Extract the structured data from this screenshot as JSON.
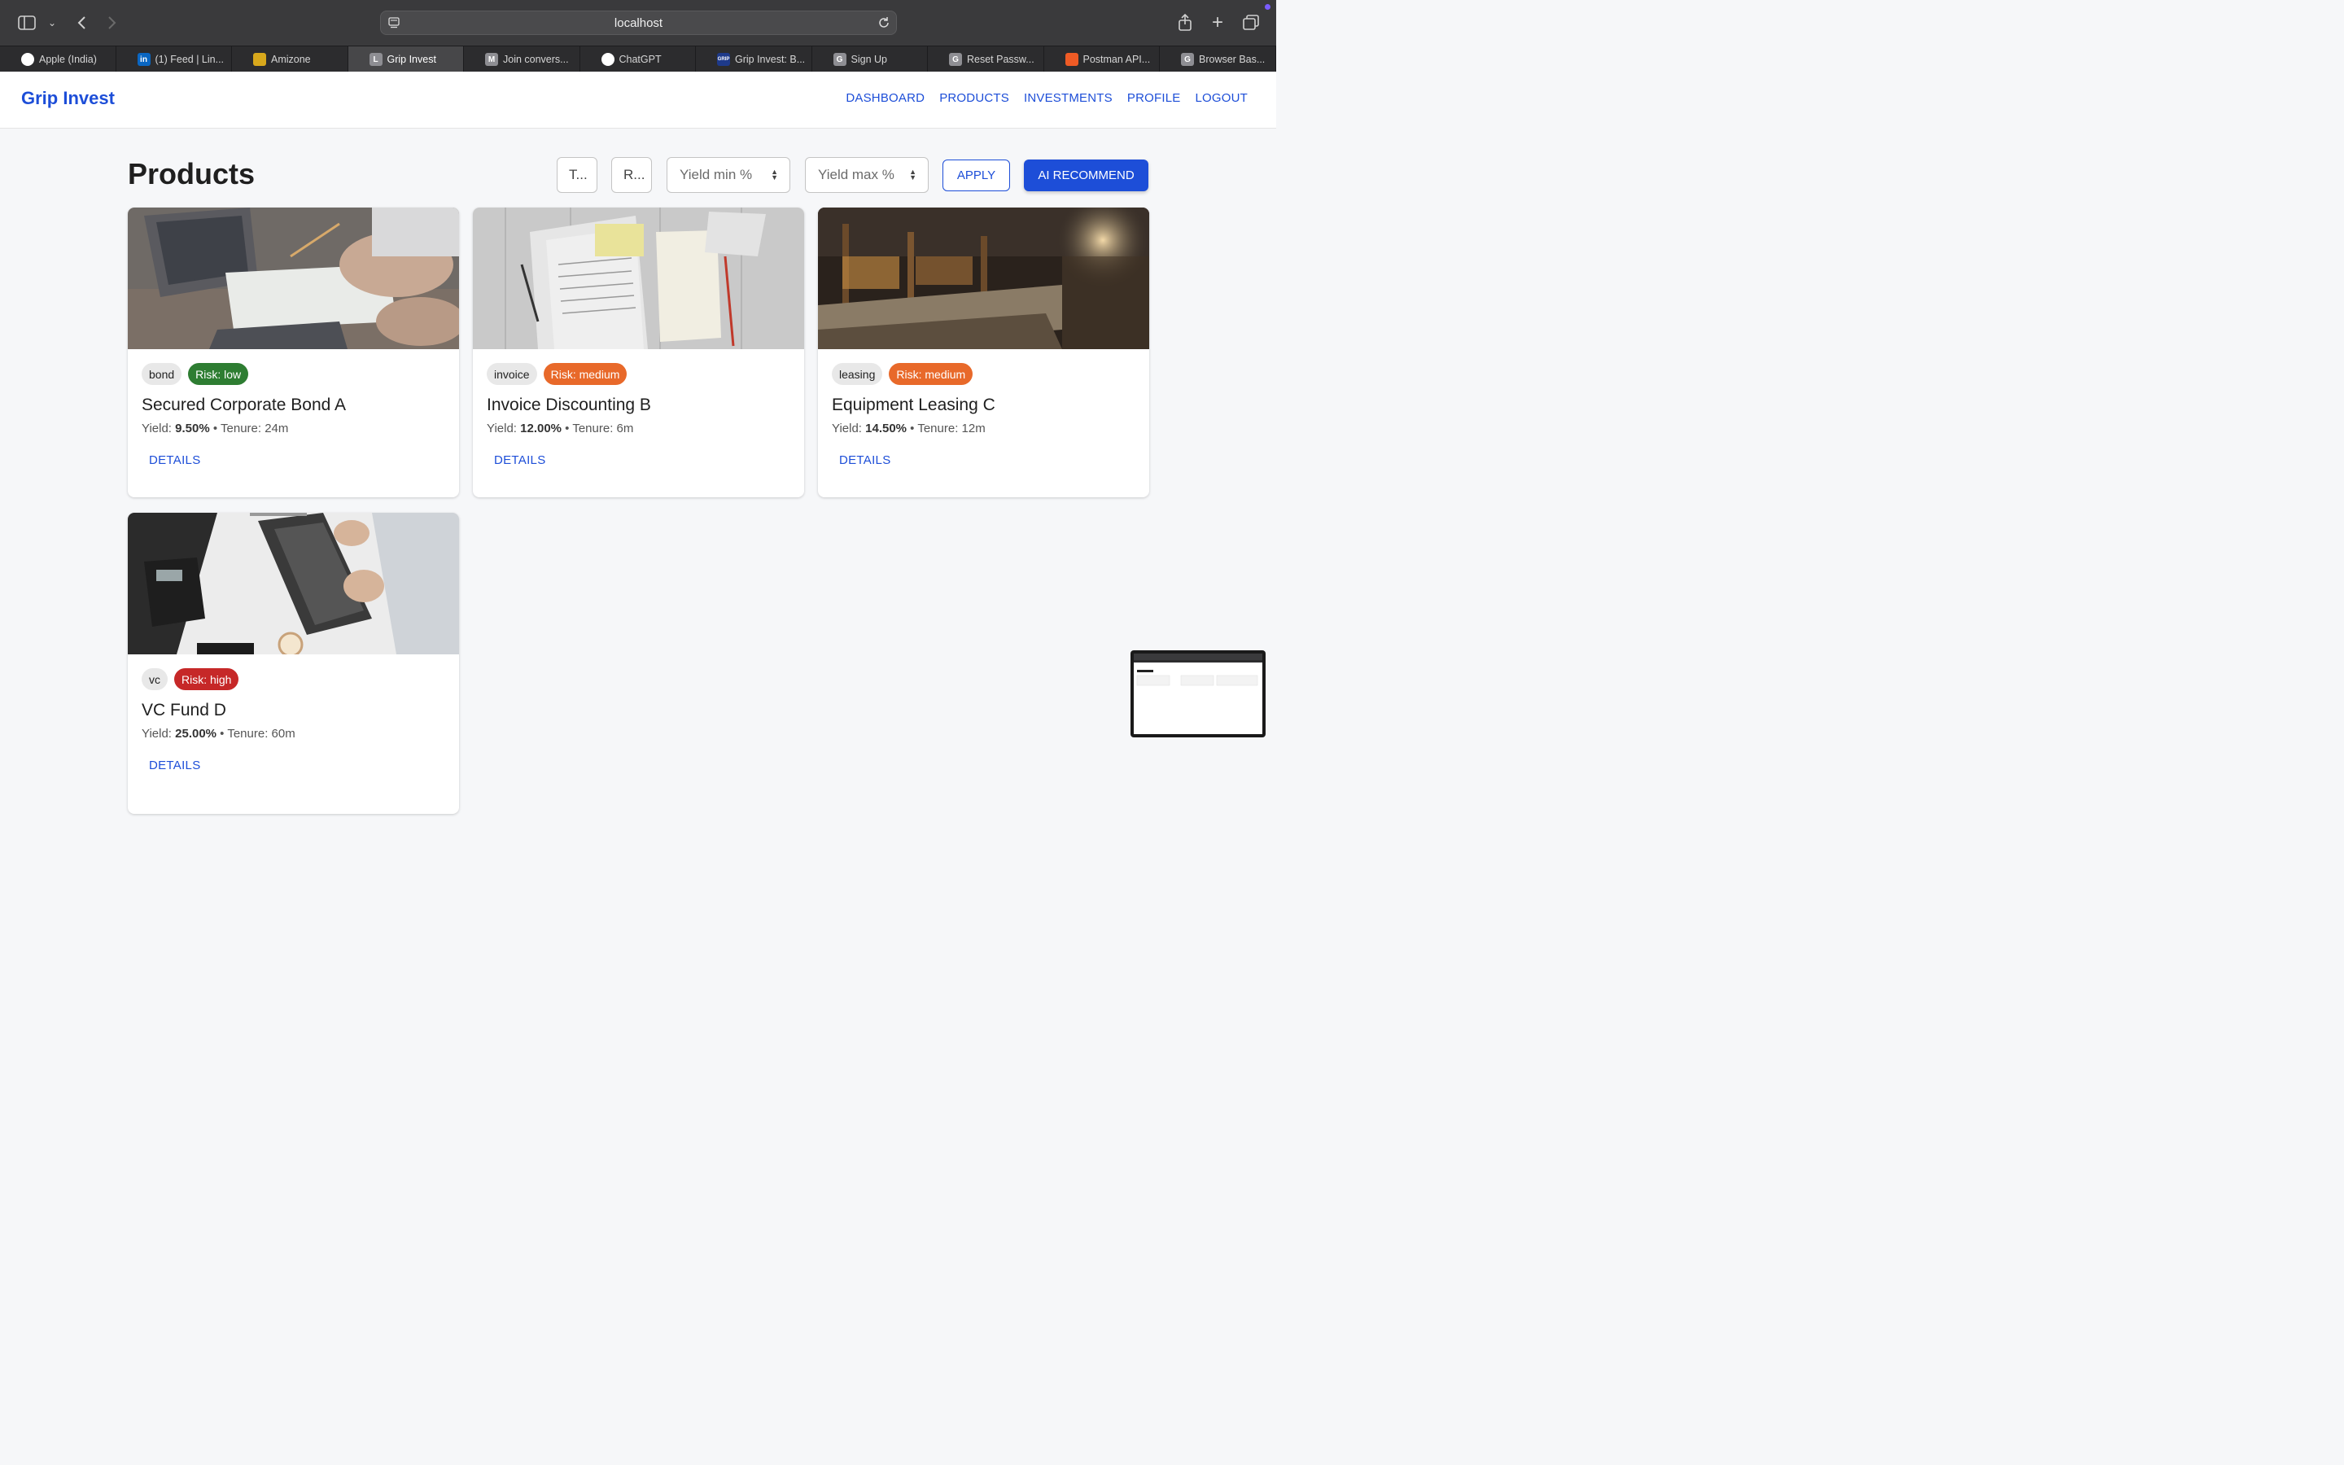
{
  "browser": {
    "url": "localhost",
    "tabs": [
      {
        "label": "Apple (India)",
        "icon": "apple-icon",
        "color": "#ffffff",
        "glyph": ""
      },
      {
        "label": "(1) Feed | Lin...",
        "icon": "linkedin-icon",
        "color": "#0a66c2",
        "glyph": "in"
      },
      {
        "label": "Amizone",
        "icon": "amizone-icon",
        "color": "#d8a81c",
        "glyph": ""
      },
      {
        "label": "Grip Invest",
        "icon": "letter-l-icon",
        "color": "#8e8e93",
        "glyph": "L",
        "active": true
      },
      {
        "label": "Join convers...",
        "icon": "letter-m-icon",
        "color": "#8e8e93",
        "glyph": "M"
      },
      {
        "label": "ChatGPT",
        "icon": "chatgpt-icon",
        "color": "#ffffff",
        "glyph": ""
      },
      {
        "label": "Grip Invest: B...",
        "icon": "grip-icon",
        "color": "#1e3a8a",
        "glyph": "GRIP"
      },
      {
        "label": "Sign Up",
        "icon": "letter-g-icon",
        "color": "#8e8e93",
        "glyph": "G"
      },
      {
        "label": "Reset Passw...",
        "icon": "letter-g-icon",
        "color": "#8e8e93",
        "glyph": "G"
      },
      {
        "label": "Postman API...",
        "icon": "postman-icon",
        "color": "#ef5b25",
        "glyph": ""
      },
      {
        "label": "Browser Bas...",
        "icon": "letter-g-icon",
        "color": "#8e8e93",
        "glyph": "G"
      }
    ]
  },
  "header": {
    "brand": "Grip Invest",
    "nav": [
      "DASHBOARD",
      "PRODUCTS",
      "INVESTMENTS",
      "PROFILE",
      "LOGOUT"
    ]
  },
  "main": {
    "title": "Products",
    "filters": {
      "type_label": "T...",
      "risk_label": "R...",
      "yield_min_placeholder": "Yield min %",
      "yield_max_placeholder": "Yield max %",
      "apply": "APPLY",
      "ai_recommend": "AI RECOMMEND"
    },
    "products": [
      {
        "type": "bond",
        "risk": "Risk: low",
        "risk_color": "#2e7d32",
        "name": "Secured Corporate Bond A",
        "yield_label": "Yield:",
        "yield": "9.50%",
        "tenure": "Tenure: 24m",
        "details": "DETAILS"
      },
      {
        "type": "invoice",
        "risk": "Risk: medium",
        "risk_color": "#e8692a",
        "name": "Invoice Discounting B",
        "yield_label": "Yield:",
        "yield": "12.00%",
        "tenure": "Tenure: 6m",
        "details": "DETAILS"
      },
      {
        "type": "leasing",
        "risk": "Risk: medium",
        "risk_color": "#e8692a",
        "name": "Equipment Leasing C",
        "yield_label": "Yield:",
        "yield": "14.50%",
        "tenure": "Tenure: 12m",
        "details": "DETAILS"
      },
      {
        "type": "vc",
        "risk": "Risk: high",
        "risk_color": "#c62828",
        "name": "VC Fund D",
        "yield_label": "Yield:",
        "yield": "25.00%",
        "tenure": "Tenure: 60m",
        "details": "DETAILS"
      }
    ]
  },
  "colors": {
    "accent": "#1d4ed8"
  }
}
